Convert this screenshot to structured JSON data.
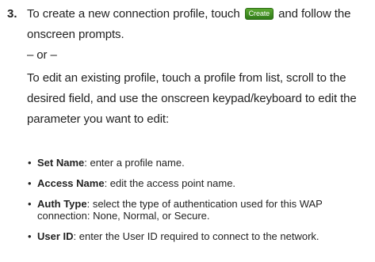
{
  "step": {
    "number": "3.",
    "text_before_button": "To create a new connection profile, touch",
    "button_label": "Create",
    "text_after_button": "and follow the onscreen prompts.",
    "or_separator": "– or –",
    "edit_instruction": "To edit an existing profile, touch a profile from list, scroll to the desired field, and use the onscreen keypad/keyboard to edit the parameter you want to edit:"
  },
  "bullets": [
    {
      "term": "Set Name",
      "description": ": enter a profile name."
    },
    {
      "term": "Access Name",
      "description": ": edit the access point name."
    },
    {
      "term": "Auth Type",
      "description": ": select the type of authentication used for this WAP connection: None, Normal, or Secure."
    },
    {
      "term": "User ID",
      "description": ": enter the User ID required to connect to the network."
    }
  ],
  "colors": {
    "text": "#222222",
    "button_green": "#3f8f20"
  }
}
